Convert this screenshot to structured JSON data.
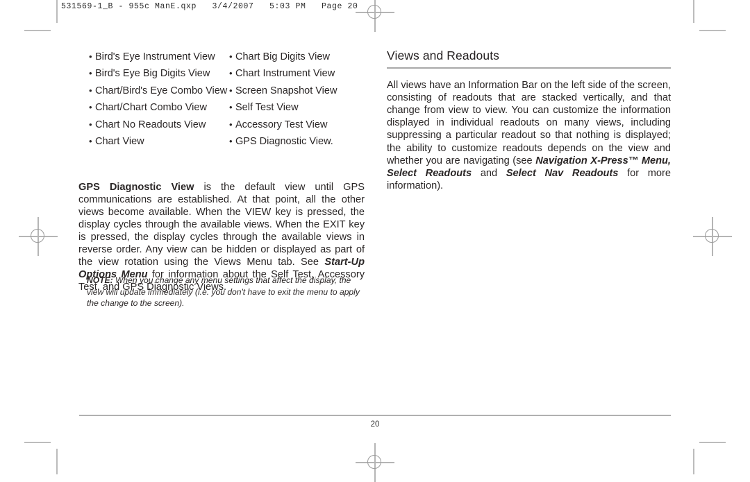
{
  "print_slug": "531569-1_B - 955c ManE.qxp   3/4/2007   5:03 PM   Page 20",
  "views_list": {
    "column_a": [
      "Bird's Eye Instrument View",
      "Bird's Eye Big Digits View",
      "Chart/Bird's Eye Combo View",
      "Chart/Chart Combo View",
      "Chart No Readouts View",
      "Chart View"
    ],
    "column_b": [
      "Chart Big Digits View",
      "Chart Instrument View",
      "Screen Snapshot View",
      "Self Test View",
      "Accessory Test View",
      "GPS Diagnostic View."
    ],
    "bullet_glyph": "•"
  },
  "gps_paragraph": {
    "lead_bold": "GPS Diagnostic View",
    "text_1": " is the default view until GPS communications are established. At that point, all the other views become available. When the VIEW key is pressed, the display cycles through the available views. When the EXIT key is pressed, the display cycles through the available views in reverse order. Any view can be hidden or displayed as part of the view rotation using the Views Menu tab. See ",
    "ref_bold_italic": "Start-Up Options Menu",
    "text_2": " for information about the Self Test, Accessory Test, and GPS Diagnostic Views."
  },
  "note": {
    "label": "NOTE:",
    "text": " When you change any menu settings that affect the display, the view will update immediately (i.e. you don't have to exit the menu to apply the change to the screen)."
  },
  "section": {
    "heading": "Views and Readouts",
    "text_1": "All views have an Information Bar on the left side of the screen, consisting of readouts that are stacked vertically, and that change from view to view. You can customize the information displayed in individual readouts on many views, including suppressing a particular readout so that nothing is displayed; the ability to customize readouts depends on the view and whether you are navigating (see ",
    "ref_1": "Navigation X-Press™ Menu, Select Readouts",
    "text_2": " and ",
    "ref_2": "Select Nav Readouts",
    "text_3": " for more information)."
  },
  "footer": {
    "page_number": "20"
  },
  "colors": {
    "text": "#2a2626",
    "rule": "#a9a9a9",
    "crop_mark": "#bcbcbc"
  }
}
